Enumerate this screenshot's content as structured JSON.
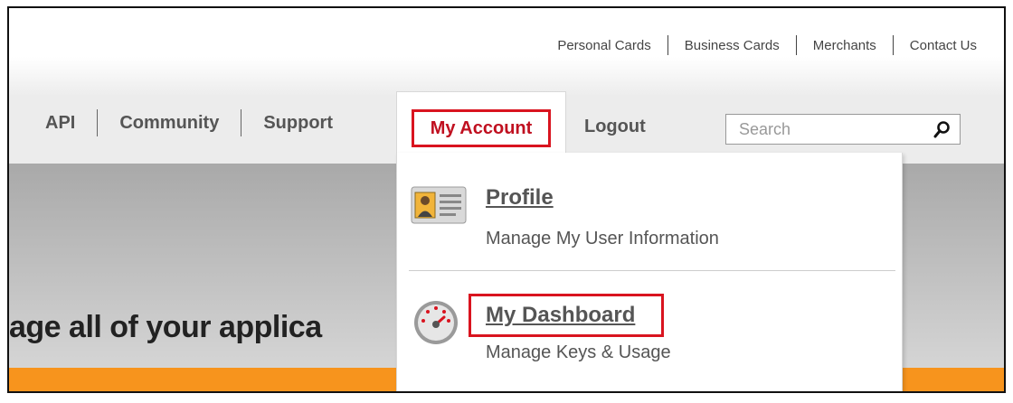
{
  "utility_nav": [
    "Personal Cards",
    "Business Cards",
    "Merchants",
    "Contact Us"
  ],
  "main_nav": [
    "API",
    "Community",
    "Support"
  ],
  "account_tab": "My Account",
  "logout": "Logout",
  "search": {
    "placeholder": "Search"
  },
  "hero_text": "age all of your applica",
  "dropdown": {
    "items": [
      {
        "title": "Profile",
        "description": "Manage My User Information",
        "icon": "profile-card-icon"
      },
      {
        "title": "My Dashboard",
        "description": "Manage Keys & Usage",
        "icon": "dashboard-gauge-icon"
      }
    ]
  },
  "colors": {
    "highlight": "#d9141f",
    "accent_orange": "#f7941d",
    "account_text": "#c01020"
  }
}
